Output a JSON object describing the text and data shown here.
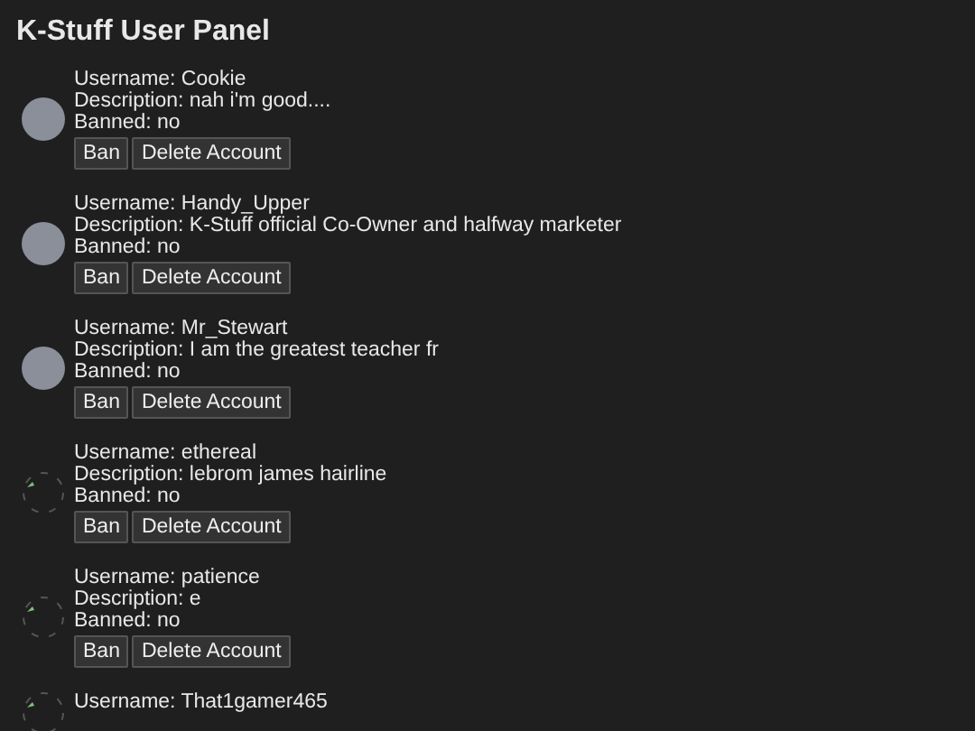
{
  "title": "K-Stuff User Panel",
  "users": [
    {
      "kind": "photo",
      "lines": [
        "Username: Cookie",
        "Description: nah i'm good....",
        "Banned: no"
      ],
      "buttons": [
        "Ban",
        "Delete Account"
      ]
    },
    {
      "kind": "photo",
      "lines": [
        "Username: Handy_Upper",
        "Description: K-Stuff official Co-Owner and halfway marketer",
        "Banned: no"
      ],
      "buttons": [
        "Ban",
        "Delete Account"
      ]
    },
    {
      "kind": "photo",
      "lines": [
        "Username: Mr_Stewart",
        "Description: I am the greatest teacher fr",
        "Banned: no"
      ],
      "buttons": [
        "Ban",
        "Delete Account"
      ]
    },
    {
      "kind": "broken",
      "lines": [
        "Username: ethereal",
        "Description: lebrom james hairline",
        "Banned: no"
      ],
      "buttons": [
        "Ban",
        "Delete Account"
      ]
    },
    {
      "kind": "broken",
      "lines": [
        "Username: patience",
        "Description: e",
        "Banned: no"
      ],
      "buttons": [
        "Ban",
        "Delete Account"
      ]
    },
    {
      "kind": "broken",
      "lines": [
        "Username: That1gamer465"
      ]
    }
  ]
}
